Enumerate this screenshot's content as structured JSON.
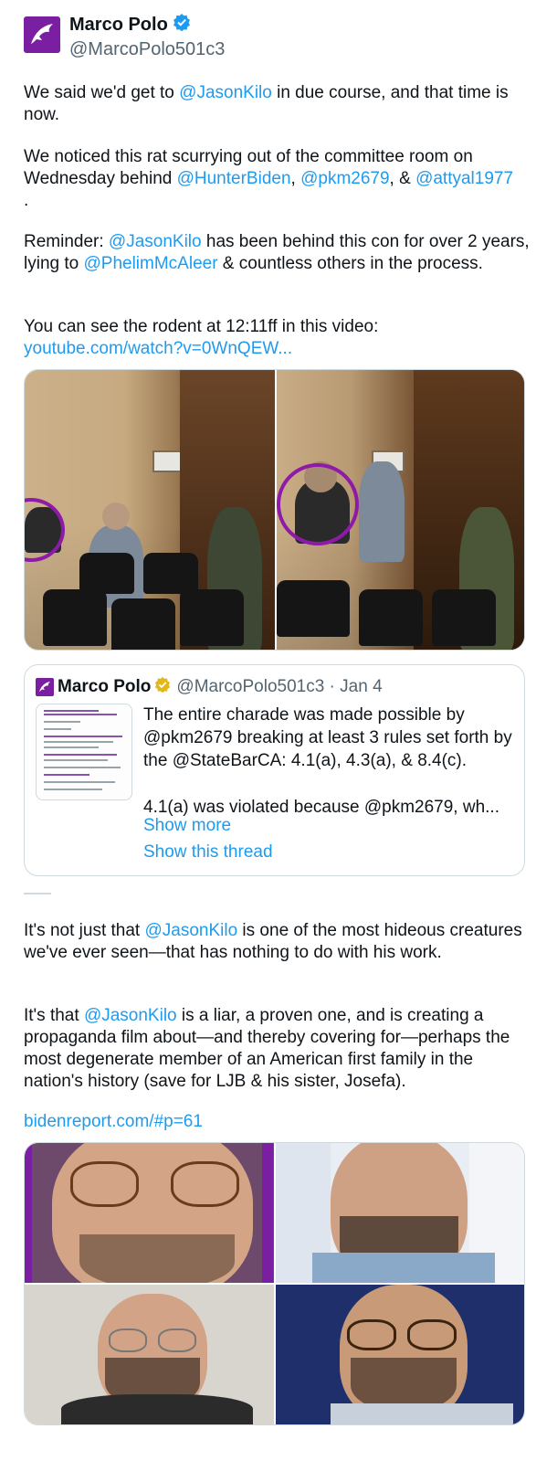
{
  "author": {
    "display_name": "Marco Polo",
    "handle": "@MarcoPolo501c3",
    "avatar_icon": "dolphin-logo-icon",
    "verified_icon": "verified-badge-icon",
    "verified_color": "#1d9bf0",
    "avatar_color": "#7b1fa2"
  },
  "tweet1": {
    "p1_a": "We said we'd get to ",
    "p1_link": "@JasonKilo",
    "p1_b": " in due course, and that time is now.",
    "p2_a": "We noticed this rat scurrying out of the committee room on Wednesday behind ",
    "p2_link1": "@HunterBiden",
    "p2_sep1": ", ",
    "p2_link2": "@pkm2679",
    "p2_sep2": ", & ",
    "p2_link3": "@attyal1977",
    "p2_end": ".",
    "p3_a": "Reminder: ",
    "p3_link1": "@JasonKilo",
    "p3_b": " has been behind this con for over 2 years, lying to ",
    "p3_link2": "@PhelimMcAleer",
    "p3_c": " & countless others in the process.",
    "p4_a": "You can see the rodent at 12:11ff in this video:",
    "p4_link": "youtube.com/watch?v=0WnQEW..."
  },
  "quote": {
    "display_name": "Marco Polo",
    "badge_icon": "gold-verified-badge-icon",
    "badge_color": "#e2b719",
    "handle_time": "@MarcoPolo501c3 · Jan 4",
    "body_1": "The entire charade was made possible by @pkm2679 breaking at least 3 rules set forth by the @StateBarCA: 4.1(a), 4.3(a), & 8.4(c).",
    "body_2": "4.1(a) was violated because @pkm2679, wh...",
    "show_more": "Show more",
    "show_thread": "Show this thread"
  },
  "tweet2": {
    "p1_a": "It's not just that ",
    "p1_link": "@JasonKilo",
    "p1_b": " is one of the most hideous creatures we've ever seen—that has nothing to do with his work.",
    "p2_a": "It's that ",
    "p2_link": "@JasonKilo",
    "p2_b": " is a liar, a proven one, and is creating a propaganda film about—and thereby covering for—perhaps the most degenerate member of an American first family in the nation's history (save for LJB & his sister, Josefa).",
    "p3_link": "bidenreport.com/#p=61"
  },
  "colors": {
    "link": "#1d9bf0",
    "text": "#0f1419",
    "muted": "#536471",
    "border": "#cfd9de",
    "circle": "#8e1aa8"
  }
}
